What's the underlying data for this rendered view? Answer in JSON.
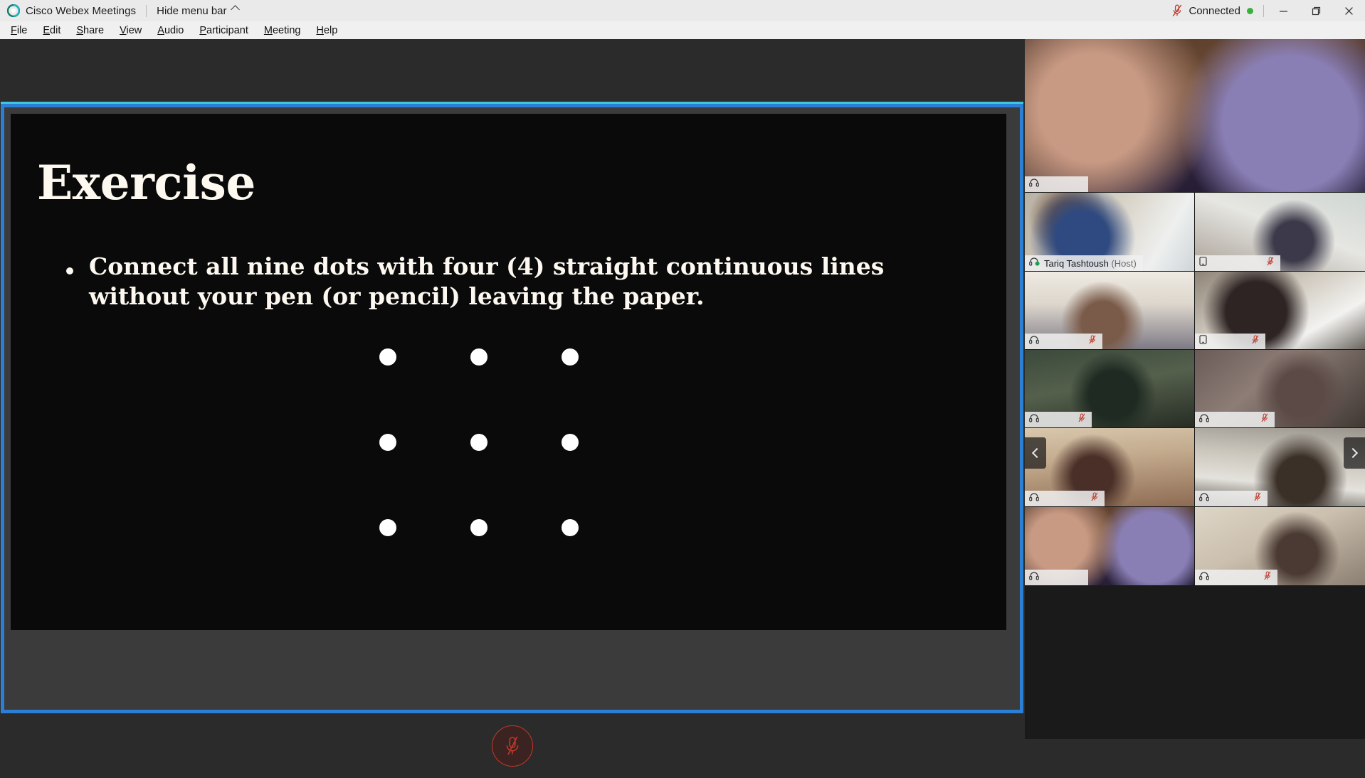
{
  "window": {
    "app_name": "Cisco Webex Meetings",
    "hide_menu_bar": "Hide menu bar",
    "connected_label": "Connected",
    "minimize_label": "Minimize",
    "restore_label": "Restore",
    "close_label": "Close",
    "mic_status_icon": "microphone-muted-icon",
    "status_dot_color": "#37b03c"
  },
  "menubar": {
    "items": [
      {
        "label": "File",
        "accel": "F"
      },
      {
        "label": "Edit",
        "accel": "E"
      },
      {
        "label": "Share",
        "accel": "S"
      },
      {
        "label": "View",
        "accel": "V"
      },
      {
        "label": "Audio",
        "accel": "A"
      },
      {
        "label": "Participant",
        "accel": "P"
      },
      {
        "label": "Meeting",
        "accel": "M"
      },
      {
        "label": "Help",
        "accel": "H"
      }
    ]
  },
  "share": {
    "border_color": "#2b7fd4",
    "accent_top_color": "#3ec8e0",
    "accent_bottom_color": "#63c222",
    "slide": {
      "title": "Exercise",
      "bullet": "Connect all nine dots with four (4) straight continuous lines without your pen (or pencil) leaving the paper.",
      "background_color": "#0a0a0a",
      "text_color": "#fdf8f0",
      "dot_grid": {
        "rows": 3,
        "columns": 3,
        "dot_count": 9,
        "dot_color": "#ffffff"
      }
    }
  },
  "toolbar": {
    "mute_button_label": "Unmute",
    "mute_button_icon": "microphone-muted-icon",
    "mute_button_color": "#c0392b"
  },
  "panel": {
    "scroll_left_label": "Previous participants",
    "scroll_right_label": "Next participants",
    "participants": [
      {
        "name": "",
        "redacted": true,
        "host": false,
        "device_icon": "headset-icon",
        "muted": false,
        "active": false,
        "video": "v-a"
      },
      {
        "name": "Tariq Tashtoush",
        "redacted": false,
        "host": true,
        "host_suffix": "(Host)",
        "device_icon": "headset-speaking-icon",
        "muted": false,
        "active": false,
        "video": "v-b"
      },
      {
        "name": "",
        "redacted": true,
        "host": false,
        "device_icon": "phone-icon",
        "muted": true,
        "active": false,
        "video": "v-c"
      },
      {
        "name": "",
        "redacted": true,
        "host": false,
        "device_icon": "headset-icon",
        "muted": true,
        "active": false,
        "video": "v-d"
      },
      {
        "name": "",
        "redacted": true,
        "host": false,
        "device_icon": "phone-icon",
        "muted": true,
        "active": false,
        "video": "v-e"
      },
      {
        "name": "",
        "redacted": true,
        "host": false,
        "device_icon": "headset-icon",
        "muted": true,
        "active": false,
        "video": "v-f"
      },
      {
        "name": "",
        "redacted": true,
        "host": false,
        "device_icon": "headset-icon",
        "muted": true,
        "active": false,
        "video": "v-g"
      },
      {
        "name": "",
        "redacted": true,
        "host": false,
        "device_icon": "headset-icon",
        "muted": true,
        "active": false,
        "video": "v-h"
      },
      {
        "name": "",
        "redacted": true,
        "host": false,
        "device_icon": "headset-icon",
        "muted": true,
        "active": false,
        "video": "v-i"
      },
      {
        "name": "",
        "redacted": true,
        "host": false,
        "device_icon": "headset-icon",
        "muted": false,
        "active": true,
        "video": "v-j"
      },
      {
        "name": "",
        "redacted": true,
        "host": false,
        "device_icon": "headset-icon",
        "muted": true,
        "active": false,
        "video": "v-k"
      }
    ]
  }
}
